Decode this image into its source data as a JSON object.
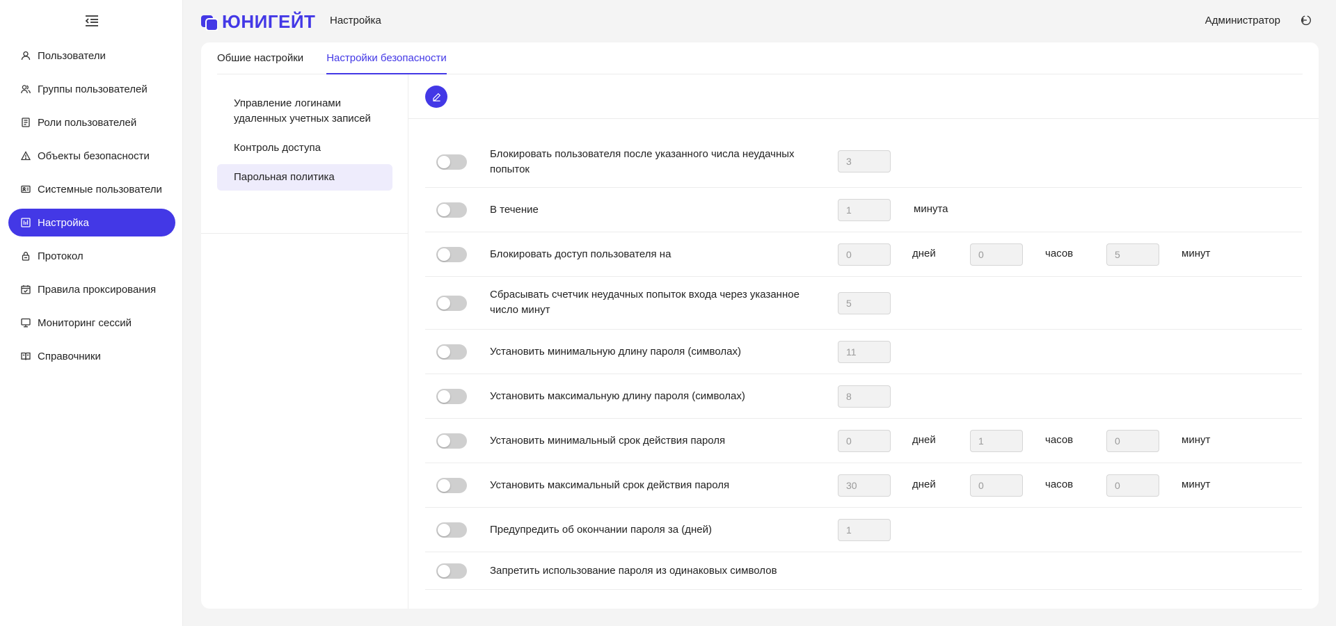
{
  "app": {
    "brand": "ЮНИГЕЙТ",
    "page_title": "Настройка",
    "user": "Администратор",
    "accent": "#4338e6"
  },
  "sidebar": {
    "items": [
      {
        "label": "Пользователи",
        "icon": "user-icon"
      },
      {
        "label": "Группы пользователей",
        "icon": "users-group-icon"
      },
      {
        "label": "Роли пользователей",
        "icon": "roles-icon"
      },
      {
        "label": "Объекты безопасности",
        "icon": "warning-triangle-icon"
      },
      {
        "label": "Системные пользователи",
        "icon": "id-card-icon"
      },
      {
        "label": "Настройка",
        "icon": "settings-chart-icon",
        "active": true
      },
      {
        "label": "Протокол",
        "icon": "lock-icon"
      },
      {
        "label": "Правила проксирования",
        "icon": "calendar-check-icon"
      },
      {
        "label": "Мониторинг сессий",
        "icon": "monitor-icon"
      },
      {
        "label": "Справочники",
        "icon": "book-icon"
      }
    ]
  },
  "tabs": [
    {
      "label": "Обшие настройки"
    },
    {
      "label": "Настройки безопасности",
      "active": true
    }
  ],
  "subnav": [
    {
      "label": "Управление логинами удаленных учетных записей"
    },
    {
      "label": "Контроль доступа"
    },
    {
      "label": "Парольная политика",
      "active": true
    }
  ],
  "units": {
    "minute": "минута",
    "days": "дней",
    "hours": "часов",
    "minutes": "минут"
  },
  "rows": [
    {
      "label": "Блокировать пользователя после указанного числа неудачных попыток",
      "values": [
        "3"
      ]
    },
    {
      "label": "В течение",
      "values": [
        "1"
      ]
    },
    {
      "label": "Блокировать доступ пользователя на",
      "values": [
        "0",
        "0",
        "5"
      ]
    },
    {
      "label": "Сбрасывать счетчик неудачных попыток входа через указанное число минут",
      "values": [
        "5"
      ]
    },
    {
      "label": "Установить минимальную длину пароля (символах)",
      "values": [
        "11"
      ]
    },
    {
      "label": "Установить максимальную длину пароля (символах)",
      "values": [
        "8"
      ]
    },
    {
      "label": "Установить минимальный срок действия пароля",
      "values": [
        "0",
        "1",
        "0"
      ]
    },
    {
      "label": "Установить максимальный срок действия пароля",
      "values": [
        "30",
        "0",
        "0"
      ]
    },
    {
      "label": "Предупредить об окончании пароля за (дней)",
      "values": [
        "1"
      ]
    },
    {
      "label": "Запретить использование пароля из одинаковых символов",
      "values": []
    }
  ]
}
